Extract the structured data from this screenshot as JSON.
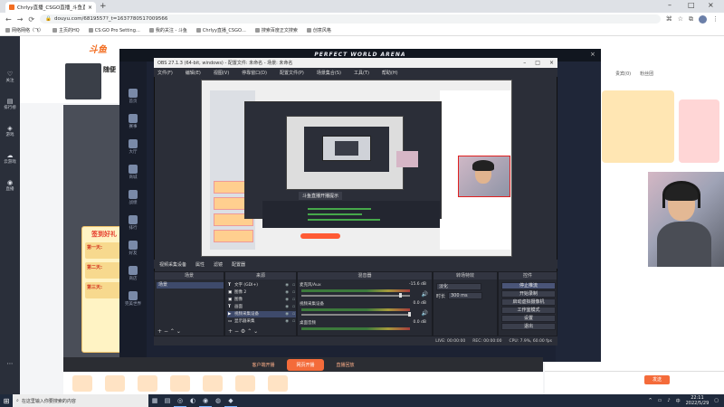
{
  "browser": {
    "tab_title": "Chrlyy直播_CSGO直播_斗鱼直",
    "new_tab": "+",
    "url": "douyu.com/6819557?_t=1637780517009566",
    "bookmarks": [
      "网络网络（飞）",
      "主页的HQ",
      "CS:GO Pro Setting…",
      "我的关注 - 斗鱼",
      "Chrlyy直播_CSGO…",
      "搜索百度正文搜索",
      "创意风格"
    ]
  },
  "douyu": {
    "logo": "斗鱼",
    "streamer_name": "随便",
    "left_nav": [
      "关注",
      "排行榜",
      "游戏",
      "云游戏",
      "直播"
    ],
    "checkin": {
      "title": "签到好礼",
      "days": [
        "第一天:",
        "第二天:",
        "第三天:"
      ]
    },
    "bottom_left": "客户端开播",
    "bottom_main": "网页开播",
    "bottom_right": "直播回放",
    "right_tabs": [
      "贵宾(0)",
      "粉丝团"
    ],
    "send": "发送"
  },
  "overlay": {
    "title": "PERFECT WORLD ARENA",
    "close": "×",
    "sidebar": [
      "首页",
      "赛事",
      "大厅",
      "商城",
      "战绩",
      "排行",
      "好友",
      "商店",
      "完美世界"
    ]
  },
  "obs": {
    "title": "OBS 27.1.3 (64-bit, windows) - 配置文件: 未命名 - 场景: 未命名",
    "menu": [
      "文件(F)",
      "编辑(E)",
      "视图(V)",
      "停靠窗口(D)",
      "配置文件(P)",
      "场景集合(S)",
      "工具(T)",
      "帮助(H)"
    ],
    "dock_tabs": [
      "视频采集设备",
      "属性",
      "滤镜",
      "配置器"
    ],
    "scenes_header": "场景",
    "scenes": [
      "场景"
    ],
    "sources_header": "来源",
    "sources": [
      "文字 (GDI+)",
      "图像 2",
      "图像",
      "画面",
      "视频采集设备",
      "显示器采集"
    ],
    "mixer_header": "混音器",
    "mixer": [
      {
        "name": "麦克风/Aux",
        "db": "-15.6 dB"
      },
      {
        "name": "视频采集设备",
        "db": "0.0 dB"
      },
      {
        "name": "桌面音频",
        "db": "0.0 dB"
      }
    ],
    "trans_header": "转场特效",
    "trans_value": "淡化",
    "trans_duration_label": "时长",
    "trans_duration": "300 ms",
    "controls_header": "控件",
    "controls": [
      "停止推流",
      "开始录制",
      "启动虚拟摄像机",
      "工作室模式",
      "设置",
      "退出"
    ],
    "nested_caption": "斗鱼直播开播提示",
    "status": {
      "live": "LIVE: 00:00:00",
      "rec": "REC: 00:00:00",
      "cpu": "CPU: 7.9%, 60.00 fps"
    }
  },
  "taskbar": {
    "search_placeholder": "在这里输入你要搜索的内容",
    "time": "22:11",
    "date": "2022/5/29",
    "lang": "中"
  }
}
